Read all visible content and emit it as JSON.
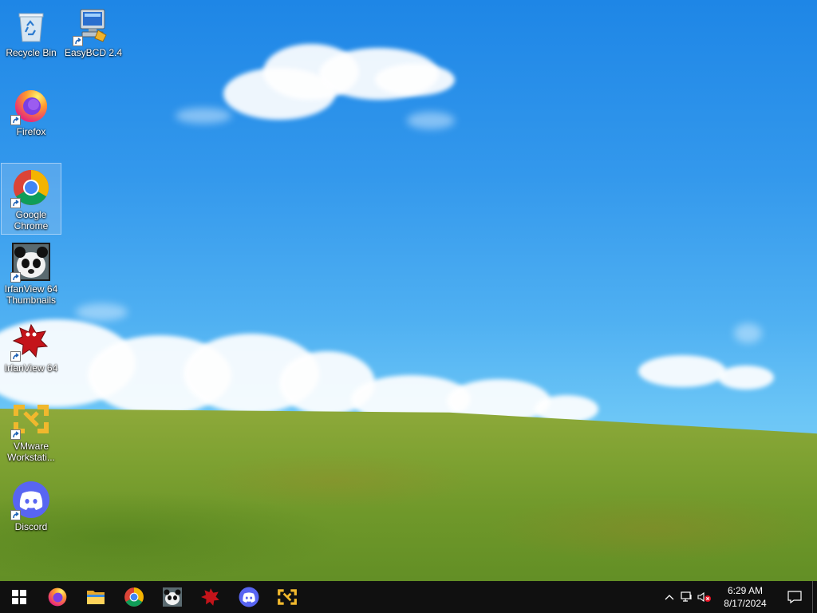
{
  "desktop": {
    "icons": [
      {
        "label": "Recycle Bin",
        "icon": "recycle-bin-icon"
      },
      {
        "label": "EasyBCD 2.4",
        "icon": "easybcd-icon"
      },
      {
        "label": "Firefox",
        "icon": "firefox-icon"
      },
      {
        "label": "Google Chrome",
        "icon": "chrome-icon",
        "selected": true
      },
      {
        "label": "IrfanView 64 Thumbnails",
        "icon": "irfanview-thumbnails-icon"
      },
      {
        "label": "IrfanView 64",
        "icon": "irfanview-icon"
      },
      {
        "label": "VMware Workstati...",
        "icon": "vmware-icon"
      },
      {
        "label": "Discord",
        "icon": "discord-icon"
      }
    ]
  },
  "taskbar": {
    "pinned": [
      "start-icon",
      "firefox-icon",
      "file-explorer-icon",
      "chrome-icon",
      "irfanview-thumbnails-icon",
      "irfanview-icon",
      "discord-icon",
      "vmware-icon"
    ],
    "tray": [
      "chevron-up-icon",
      "network-icon",
      "volume-muted-icon"
    ],
    "clock": {
      "time": "6:29 AM",
      "date": "8/17/2024"
    },
    "notification": "action-center-icon"
  },
  "colors": {
    "sky": "#3398ec",
    "grass": "#7fa232",
    "taskbar": "#101010",
    "chrome_red": "#db4437",
    "discord": "#5865f2",
    "vmware": "#f1b82d"
  }
}
